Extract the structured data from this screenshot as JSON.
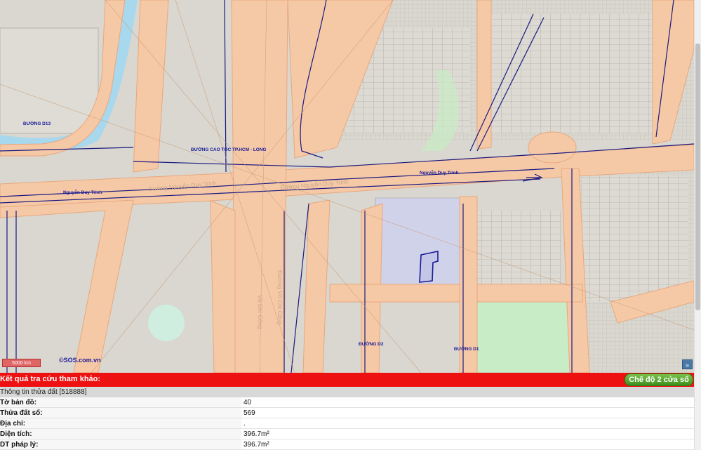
{
  "map": {
    "road_labels": [
      "ĐƯỜNG D13",
      "ĐƯỜNG CAO TỐC TP.HCM - LONG",
      "Nguyễn Duy Trinh",
      "Nguyễn Duy Trinh",
      "ĐƯỜNG D2",
      "ĐƯỜNG D1"
    ],
    "faint_labels": [
      "Đường Nguyễn Duy Trinh",
      "Đường Nguyễn Duy Trinh",
      "Võ Chí Công",
      "Đường Võ Chí Công"
    ],
    "scale": "5000 km",
    "copyright": "©SOS.com.vn",
    "expand_icon": "»",
    "colors": {
      "road_fill": "#f6c9a6",
      "road_outline": "#e8a77e",
      "parcel_fill": "#d9d7cf",
      "canal": "#a8d8ee",
      "green": "#c8ecc5",
      "highlight_parcel": "#d0d2ea",
      "boundary": "#1a1a80"
    }
  },
  "result": {
    "title": "Kết quả tra cứu tham khảo:",
    "mode_button": "Chế độ 2 cửa sổ",
    "parcel_header": "Thông tin thửa đất [518888]",
    "rows": [
      {
        "label": "Tờ bản đồ:",
        "value": "40"
      },
      {
        "label": "Thửa đất số:",
        "value": "569"
      },
      {
        "label": "Địa chỉ:",
        "value": "."
      },
      {
        "label": "Diện tích:",
        "value": "396.7m²"
      },
      {
        "label": "DT pháp lý:",
        "value": "396.7m²"
      }
    ]
  }
}
